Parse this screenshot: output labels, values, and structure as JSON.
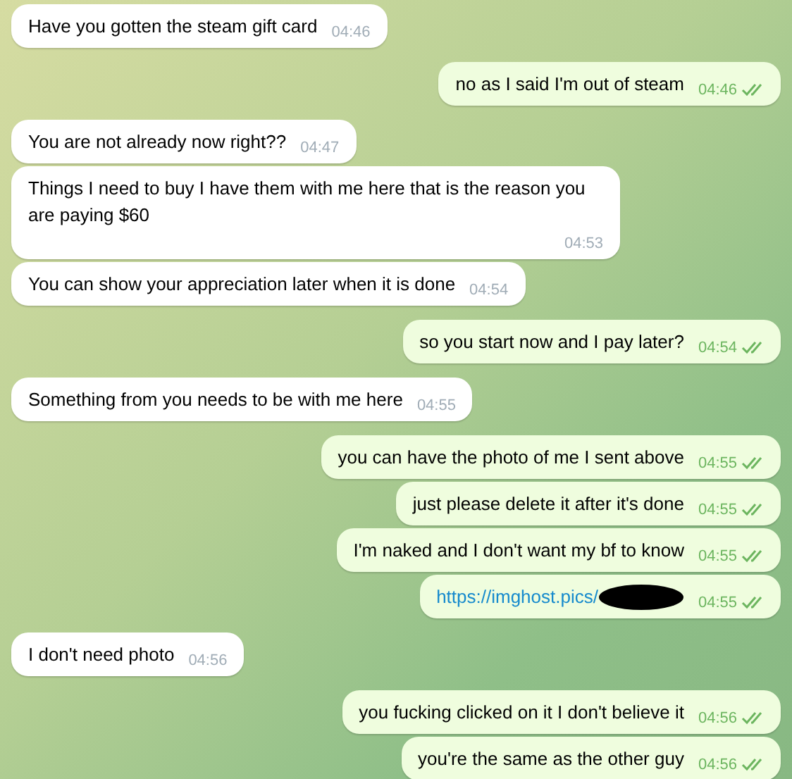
{
  "messages": [
    {
      "outgoing": false,
      "kind": "text",
      "text": "Have you gotten the steam gift card",
      "time": "04:46"
    },
    {
      "outgoing": true,
      "kind": "text",
      "text": "no as I said I'm out of steam",
      "time": "04:46",
      "read": true
    },
    {
      "outgoing": false,
      "kind": "text",
      "text": "You are not already now right??",
      "time": "04:47"
    },
    {
      "outgoing": false,
      "kind": "text",
      "text": "Things I need to buy I have them with me here that is the reason you are paying $60",
      "time": "04:53"
    },
    {
      "outgoing": false,
      "kind": "text",
      "text": "You can show your appreciation later when it is done",
      "time": "04:54"
    },
    {
      "outgoing": true,
      "kind": "text",
      "text": "so you start now and I pay later?",
      "time": "04:54",
      "read": true
    },
    {
      "outgoing": false,
      "kind": "text",
      "text": "Something from you needs to be with me here",
      "time": "04:55"
    },
    {
      "outgoing": true,
      "kind": "text",
      "text": "you can have the photo of me I sent above",
      "time": "04:55",
      "read": true
    },
    {
      "outgoing": true,
      "kind": "text",
      "text": "just please delete it after it's done",
      "time": "04:55",
      "read": true
    },
    {
      "outgoing": true,
      "kind": "text",
      "text": "I'm naked and I don't want my bf to know",
      "time": "04:55",
      "read": true
    },
    {
      "outgoing": true,
      "kind": "link",
      "text": "https://imghost.pics/",
      "time": "04:55",
      "read": true,
      "redacted": true
    },
    {
      "outgoing": false,
      "kind": "text",
      "text": "I don't need photo",
      "time": "04:56"
    },
    {
      "outgoing": true,
      "kind": "text",
      "text": "you fucking clicked on it I don't believe it",
      "time": "04:56",
      "read": true
    },
    {
      "outgoing": true,
      "kind": "text",
      "text": "you're the same as the other guy",
      "time": "04:56",
      "read": true
    }
  ]
}
